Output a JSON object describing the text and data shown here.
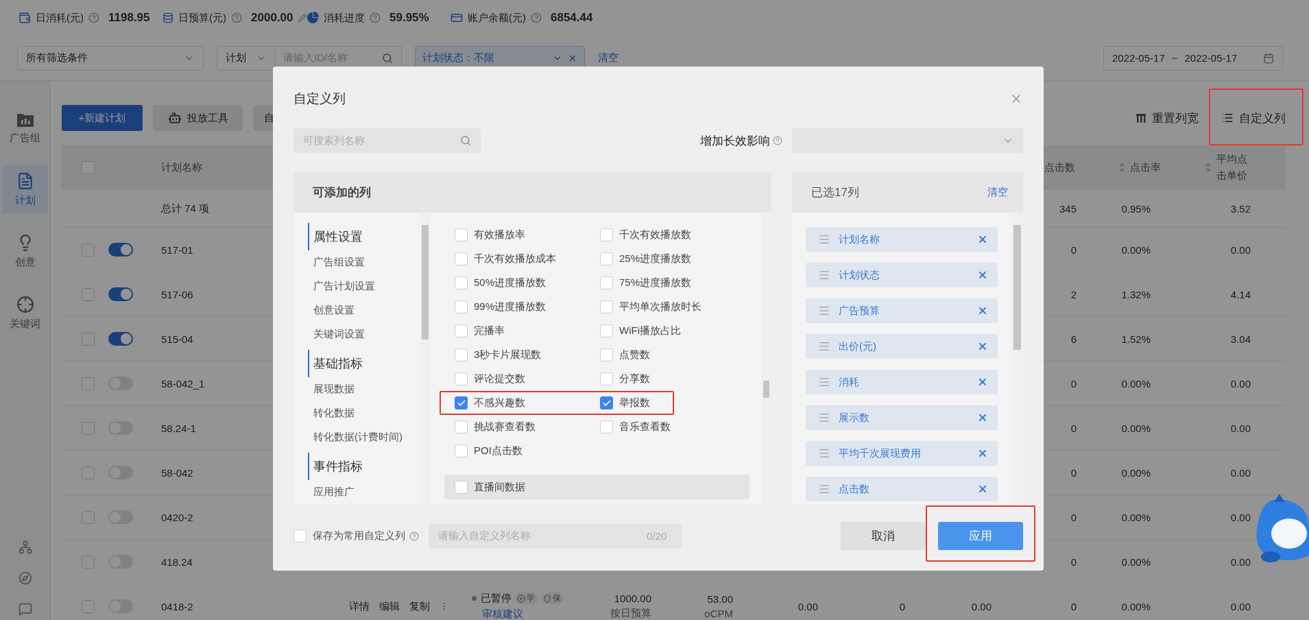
{
  "stats": [
    {
      "kind": "spend",
      "label": "日消耗(元)",
      "value": "1198.95",
      "editable": false
    },
    {
      "kind": "budget",
      "label": "日预算(元)",
      "value": "2000.00",
      "editable": true
    },
    {
      "kind": "progress",
      "label": "消耗进度",
      "value": "59.95%",
      "editable": false
    },
    {
      "kind": "balance",
      "label": "账户余额(元)",
      "value": "6854.44",
      "editable": false
    }
  ],
  "filters": {
    "preset": "所有筛选条件",
    "scope": "计划",
    "search_placeholder": "请输入ID/名称",
    "tag": "计划状态：不限",
    "clear": "清空",
    "date_from": "2022-05-17",
    "date_sep": "~",
    "date_to": "2022-05-17"
  },
  "sidebar": {
    "items": [
      {
        "kind": "group",
        "label": "广告组",
        "selected": false
      },
      {
        "kind": "plan",
        "label": "计划",
        "selected": true
      },
      {
        "kind": "creative",
        "label": "创意",
        "selected": false
      },
      {
        "kind": "keyword",
        "label": "关键词",
        "selected": false
      }
    ]
  },
  "toolbar": {
    "buttons": [
      {
        "kind": "primary",
        "label": "+新建计划"
      },
      {
        "kind": "tool",
        "label": "投放工具"
      },
      {
        "kind": "plain",
        "label": "自"
      }
    ],
    "reset_width": "重置列宽",
    "custom_columns": {
      "label": "自定义列",
      "highlighted": true
    }
  },
  "table": {
    "select_all": {
      "checked": false
    },
    "columns": [
      {
        "label": "计划名称",
        "sort": false
      },
      {
        "label": "点击数"
      },
      {
        "label": "点击率",
        "sort": true
      },
      {
        "label": "平均点击单价",
        "sort": true
      }
    ],
    "total": {
      "name": "总计 74 项",
      "clicks": "345",
      "ctr": "0.95%",
      "cpc": "3.52"
    },
    "rows": [
      {
        "checked": false,
        "on": true,
        "name": "517-01",
        "clicks": "0",
        "ctr": "0.00%",
        "cpc": "0.00"
      },
      {
        "checked": false,
        "on": true,
        "name": "517-06",
        "clicks": "2",
        "ctr": "1.32%",
        "cpc": "4.14"
      },
      {
        "checked": false,
        "on": true,
        "name": "515-04",
        "clicks": "6",
        "ctr": "1.52%",
        "cpc": "3.04"
      },
      {
        "checked": false,
        "on": false,
        "name": "58-042_1",
        "clicks": "0",
        "ctr": "0.00%",
        "cpc": "0.00"
      },
      {
        "checked": false,
        "on": false,
        "name": "58.24-1",
        "clicks": "0",
        "ctr": "0.00%",
        "cpc": "0.00"
      },
      {
        "checked": false,
        "on": false,
        "name": "58-042",
        "clicks": "0",
        "ctr": "0.00%",
        "cpc": "0.00"
      },
      {
        "checked": false,
        "on": false,
        "name": "0420-2",
        "clicks": "0",
        "ctr": "0.00%",
        "cpc": "0.00"
      },
      {
        "checked": false,
        "on": false,
        "name": "418.24",
        "clicks": "0",
        "ctr": "0.00%",
        "cpc": "0.00"
      },
      {
        "checked": false,
        "on": false,
        "name": "0418-2",
        "actions": [
          "详情",
          "编辑",
          "复制"
        ],
        "status": "已暂停",
        "badges": [
          "学",
          "保"
        ],
        "status_link": "审核建议",
        "budget": "1000.00",
        "budget_type": "按日预算",
        "bid": "53.00",
        "bid_type": "oCPM",
        "col_a": "0.00",
        "col_b": "0",
        "col_c": "0.00",
        "clicks": "0",
        "ctr": "0.00%",
        "cpc": "0.00"
      }
    ]
  },
  "modal": {
    "title": "自定义列",
    "search_placeholder": "可搜索列名称",
    "impact_label": "增加长效影响",
    "available": {
      "title": "可添加的列",
      "categories": [
        {
          "title": "属性设置",
          "items": [
            "广告组设置",
            "广告计划设置",
            "创意设置",
            "关键词设置"
          ]
        },
        {
          "title": "基础指标",
          "items": [
            "展现数据",
            "转化数据",
            "转化数据(计费时间)"
          ]
        },
        {
          "title": "事件指标",
          "items": [
            "应用推广"
          ]
        }
      ],
      "rows": [
        {
          "highlighted": false,
          "items": [
            {
              "label": "有效播放率",
              "checked": false
            },
            {
              "label": "千次有效播放数",
              "checked": false
            }
          ]
        },
        {
          "highlighted": false,
          "items": [
            {
              "label": "千次有效播放成本",
              "checked": false
            },
            {
              "label": "25%进度播放数",
              "checked": false
            }
          ]
        },
        {
          "highlighted": false,
          "items": [
            {
              "label": "50%进度播放数",
              "checked": false
            },
            {
              "label": "75%进度播放数",
              "checked": false
            }
          ]
        },
        {
          "highlighted": false,
          "items": [
            {
              "label": "99%进度播放数",
              "checked": false
            },
            {
              "label": "平均单次播放时长",
              "checked": false
            }
          ]
        },
        {
          "highlighted": false,
          "items": [
            {
              "label": "完播率",
              "checked": false
            },
            {
              "label": "WiFi播放占比",
              "checked": false
            }
          ]
        },
        {
          "highlighted": false,
          "items": [
            {
              "label": "3秒卡片展现数",
              "checked": false
            },
            {
              "label": "点赞数",
              "checked": false
            }
          ]
        },
        {
          "highlighted": false,
          "items": [
            {
              "label": "评论提交数",
              "checked": false
            },
            {
              "label": "分享数",
              "checked": false
            }
          ]
        },
        {
          "highlighted": true,
          "items": [
            {
              "label": "不感兴趣数",
              "checked": true
            },
            {
              "label": "举报数",
              "checked": true
            }
          ]
        },
        {
          "highlighted": false,
          "items": [
            {
              "label": "挑战赛查看数",
              "checked": false
            },
            {
              "label": "音乐查看数",
              "checked": false
            }
          ]
        },
        {
          "highlighted": false,
          "items": [
            {
              "label": "POI点击数",
              "checked": false
            }
          ]
        }
      ],
      "sections": [
        {
          "label": "直播间数据",
          "checked": false
        }
      ]
    },
    "selected": {
      "title": "已选17列",
      "clear": "清空",
      "items": [
        "计划名称",
        "计划状态",
        "广告预算",
        "出价(元)",
        "消耗",
        "展示数",
        "平均千次展现费用",
        "点击数"
      ]
    },
    "save": {
      "label": "保存为常用自定义列",
      "checked": false
    },
    "name_field": {
      "placeholder": "请输入自定义列名称",
      "counter": "0/20"
    },
    "cancel": "取消",
    "apply": {
      "label": "应用",
      "highlighted": true
    }
  }
}
